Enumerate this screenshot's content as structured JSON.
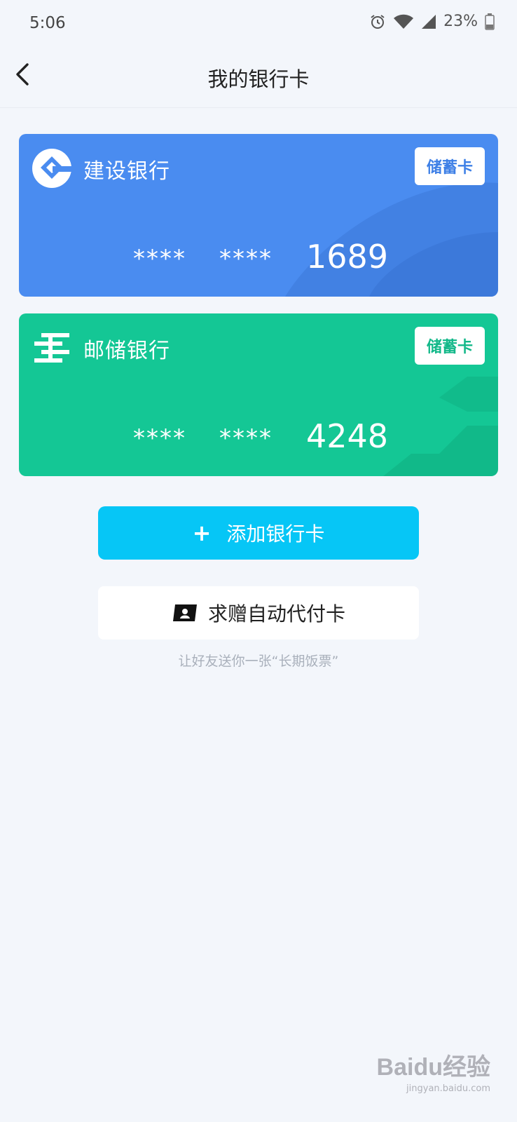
{
  "status_bar": {
    "time": "5:06",
    "battery": "23%",
    "icons": [
      "alarm-icon",
      "wifi-icon",
      "signal-icon",
      "battery-icon"
    ]
  },
  "nav": {
    "title": "我的银行卡",
    "back_icon": "chevron-left-icon"
  },
  "cards": [
    {
      "bank_name": "建设银行",
      "card_type": "储蓄卡",
      "mask1": "****",
      "mask2": "****",
      "last4": "1689",
      "color": "#4a8cf0",
      "logo_icon": "ccb-logo-icon"
    },
    {
      "bank_name": "邮储银行",
      "card_type": "储蓄卡",
      "mask1": "****",
      "mask2": "****",
      "last4": "4248",
      "color": "#14c795",
      "logo_icon": "psbc-logo-icon"
    }
  ],
  "actions": {
    "add_plus": "+",
    "add_label": "添加银行卡",
    "gift_label": "求赠自动代付卡",
    "gift_sub": "让好友送你一张“长期饭票”"
  },
  "colors": {
    "background": "#f3f6fb",
    "add_button": "#06c6f6"
  },
  "watermark": {
    "logo": "Baidu经验",
    "url": "jingyan.baidu.com"
  }
}
